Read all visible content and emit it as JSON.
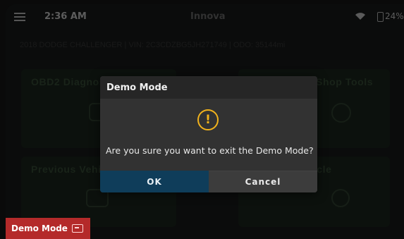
{
  "status_bar": {
    "time": "2:36 AM",
    "app_title": "Innova",
    "battery": "24%"
  },
  "vehicle_info": "2018 DODGE CHALLENGER | VIN: 2C3CDZBG5JH271749 | ODO: 35144mi",
  "tiles": {
    "obd2": "OBD2 Diagnostics",
    "shop_tools": "Shop Tools",
    "previous_vehicles": "Previous Vehicles",
    "vehicle_right": "Vehicle"
  },
  "dialog": {
    "title": "Demo Mode",
    "message": "Are you sure you want to exit the Demo Mode?",
    "ok_label": "OK",
    "cancel_label": "Cancel"
  },
  "demo_badge": {
    "label": "Demo Mode"
  },
  "colors": {
    "ok_button": "#0f3d5a",
    "warning": "#f2b31c",
    "demo_badge": "#b42a2a"
  }
}
